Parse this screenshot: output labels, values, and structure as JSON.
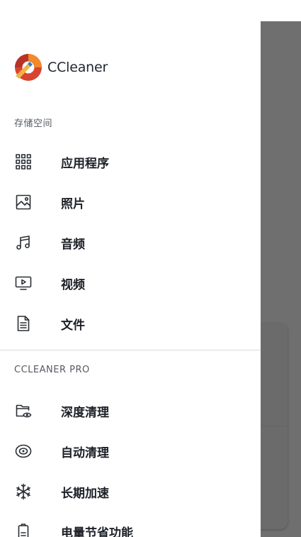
{
  "brand": {
    "name": "CCleaner"
  },
  "drawer": {
    "storage_section": {
      "title": "存储空间",
      "items": [
        {
          "label": "应用程序",
          "icon": "apps-grid-icon"
        },
        {
          "label": "照片",
          "icon": "image-icon"
        },
        {
          "label": "音频",
          "icon": "music-note-icon"
        },
        {
          "label": "视频",
          "icon": "video-play-icon"
        },
        {
          "label": "文件",
          "icon": "document-icon"
        }
      ]
    },
    "pro_section": {
      "title": "CCLEANER PRO",
      "items": [
        {
          "label": "深度清理",
          "icon": "folder-eye-icon"
        },
        {
          "label": "自动清理",
          "icon": "auto-clean-icon"
        },
        {
          "label": "长期加速",
          "icon": "snowflake-icon"
        },
        {
          "label": "电量节省功能",
          "icon": "battery-icon"
        }
      ]
    }
  }
}
